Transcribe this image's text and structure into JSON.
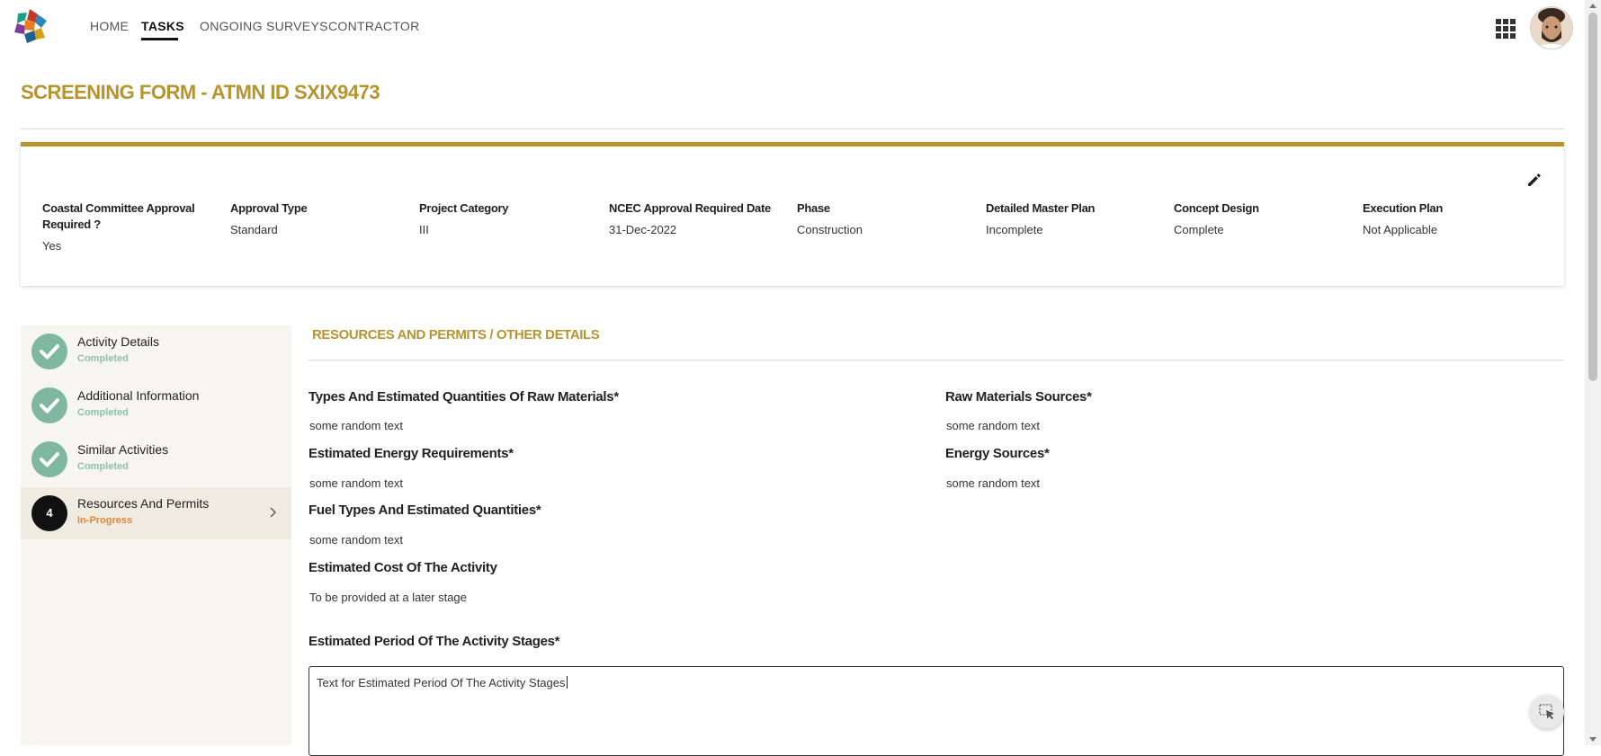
{
  "nav": {
    "items": [
      {
        "label": "HOME"
      },
      {
        "label": "TASKS"
      },
      {
        "label": "ONGOING SURVEYS"
      },
      {
        "label": "CONTRACTOR"
      }
    ],
    "active": "TASKS"
  },
  "page": {
    "title": "SCREENING FORM - ATMN ID SXIX9473"
  },
  "summary": {
    "fields": [
      {
        "label": "Coastal Committee Approval Required ?",
        "value": "Yes"
      },
      {
        "label": "Approval Type",
        "value": "Standard"
      },
      {
        "label": "Project Category",
        "value": "III"
      },
      {
        "label": "NCEC Approval Required Date",
        "value": "31-Dec-2022"
      },
      {
        "label": "Phase",
        "value": "Construction"
      },
      {
        "label": "Detailed Master Plan",
        "value": "Incomplete"
      },
      {
        "label": "Concept Design",
        "value": "Complete"
      },
      {
        "label": "Execution Plan",
        "value": "Not Applicable"
      }
    ]
  },
  "steps": [
    {
      "title": "Activity Details",
      "status": "Completed"
    },
    {
      "title": "Additional Information",
      "status": "Completed"
    },
    {
      "title": "Similar Activities",
      "status": "Completed"
    },
    {
      "number": "4",
      "title": "Resources And Permits",
      "status": "In-Progress"
    }
  ],
  "section": {
    "title": "RESOURCES AND PERMITS / OTHER DETAILS",
    "raw_materials": {
      "label": "Types And Estimated Quantities Of Raw Materials*",
      "value": "some random text"
    },
    "raw_sources": {
      "label": "Raw Materials Sources*",
      "value": "some random text"
    },
    "energy_req": {
      "label": "Estimated Energy Requirements*",
      "value": "some random text"
    },
    "energy_sources": {
      "label": "Energy Sources*",
      "value": "some random text"
    },
    "fuel_types": {
      "label": "Fuel Types And Estimated Quantities*",
      "value": "some random text"
    },
    "cost": {
      "label": "Estimated Cost Of  The Activity",
      "value": "To be provided at a later stage"
    },
    "period": {
      "label": "Estimated Period Of The Activity Stages*",
      "value": "Text for Estimated Period Of The Activity Stages"
    }
  },
  "colors": {
    "accent": "#b8942e",
    "completed": "#7fb7a0",
    "in_progress": "#e0873c"
  },
  "icons": [
    "app-logo-icon",
    "apps-grid-icon",
    "avatar",
    "edit-pencil-icon",
    "check-icon",
    "chevron-right-icon",
    "select-cursor-icon"
  ]
}
